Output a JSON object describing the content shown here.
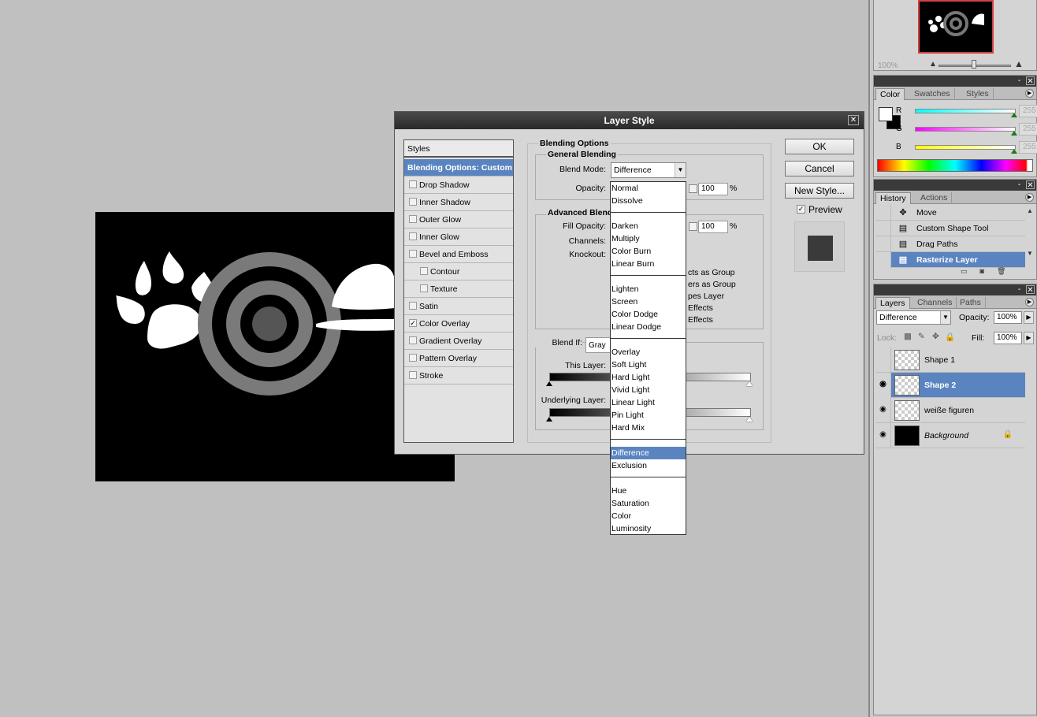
{
  "dialog": {
    "title": "Layer Style",
    "close_glyph": "✕",
    "styles_list": {
      "header": "Styles",
      "selected": "Blending Options: Custom",
      "items": [
        {
          "label": "Drop Shadow",
          "checked": false
        },
        {
          "label": "Inner Shadow",
          "checked": false
        },
        {
          "label": "Outer Glow",
          "checked": false
        },
        {
          "label": "Inner Glow",
          "checked": false
        },
        {
          "label": "Bevel and Emboss",
          "checked": false
        },
        {
          "label": "Contour",
          "checked": false
        },
        {
          "label": "Texture",
          "checked": false
        },
        {
          "label": "Satin",
          "checked": false
        },
        {
          "label": "Color Overlay",
          "checked": true
        },
        {
          "label": "Gradient Overlay",
          "checked": false
        },
        {
          "label": "Pattern Overlay",
          "checked": false
        },
        {
          "label": "Stroke",
          "checked": false
        }
      ]
    },
    "blending": {
      "section_title": "Blending Options",
      "general_title": "General Blending",
      "blend_mode_label": "Blend Mode:",
      "blend_mode_value": "Difference",
      "opacity_label": "Opacity:",
      "opacity_value": "100",
      "percent": "%",
      "advanced_title": "Advanced Blend",
      "fill_opacity_label": "Fill Opacity:",
      "fill_opacity_value": "100",
      "channels_label": "Channels:",
      "knockout_label": "Knockout:",
      "partial_options": [
        "cts as Group",
        "ers as Group",
        "pes Layer",
        "Effects",
        "Effects"
      ],
      "blend_if_label": "Blend If:",
      "blend_if_value": "Gray",
      "this_layer_label": "This Layer:",
      "underlying_label": "Underlying Layer:"
    },
    "buttons": {
      "ok": "OK",
      "cancel": "Cancel",
      "new_style": "New Style...",
      "preview": "Preview"
    }
  },
  "blend_menu": {
    "groups": [
      [
        "Normal",
        "Dissolve"
      ],
      [
        "Darken",
        "Multiply",
        "Color Burn",
        "Linear Burn"
      ],
      [
        "Lighten",
        "Screen",
        "Color Dodge",
        "Linear Dodge"
      ],
      [
        "Overlay",
        "Soft Light",
        "Hard Light",
        "Vivid Light",
        "Linear Light",
        "Pin Light",
        "Hard Mix"
      ],
      [
        "Difference",
        "Exclusion"
      ],
      [
        "Hue",
        "Saturation",
        "Color",
        "Luminosity"
      ]
    ],
    "selected": "Difference"
  },
  "navigator": {
    "zoom": "100%"
  },
  "color_panel": {
    "tabs": [
      "Color",
      "Swatches",
      "Styles"
    ],
    "channels": [
      {
        "label": "R",
        "value": "255",
        "gradient": "linear-gradient(to right, #00ffff, #ffffff)"
      },
      {
        "label": "G",
        "value": "255",
        "gradient": "linear-gradient(to right, #ff00ff, #ffffff)"
      },
      {
        "label": "B",
        "value": "255",
        "gradient": "linear-gradient(to right, #ffff00, #ffffff)"
      }
    ]
  },
  "history_panel": {
    "tabs": [
      "History",
      "Actions"
    ],
    "items": [
      {
        "label": "Move",
        "icon": "move-icon",
        "glyph": "✥"
      },
      {
        "label": "Custom Shape Tool",
        "icon": "history-state-icon",
        "glyph": "▤"
      },
      {
        "label": "Drag Paths",
        "icon": "history-state-icon",
        "glyph": "▤"
      },
      {
        "label": "Rasterize Layer",
        "icon": "history-state-icon",
        "glyph": "▤"
      }
    ],
    "selected": "Rasterize Layer",
    "footer_glyphs": "▭◙🗑"
  },
  "layers_panel": {
    "tabs": [
      "Layers",
      "Channels",
      "Paths"
    ],
    "blend_mode": "Difference",
    "opacity_label": "Opacity:",
    "opacity_value": "100%",
    "lock_label": "Lock:",
    "fill_label": "Fill:",
    "fill_value": "100%",
    "layers": [
      {
        "name": "Shape 1",
        "visible": false,
        "thumb": "checker"
      },
      {
        "name": "Shape 2",
        "visible": true,
        "thumb": "checker",
        "selected": true
      },
      {
        "name": "weiße figuren",
        "visible": true,
        "thumb": "checker"
      },
      {
        "name": "Background",
        "visible": true,
        "thumb": "black",
        "locked": true
      }
    ]
  },
  "colors": {
    "selection": "#5a84c0",
    "titlebar": "#2a2a2a",
    "workspace": "#c0c0c0"
  }
}
